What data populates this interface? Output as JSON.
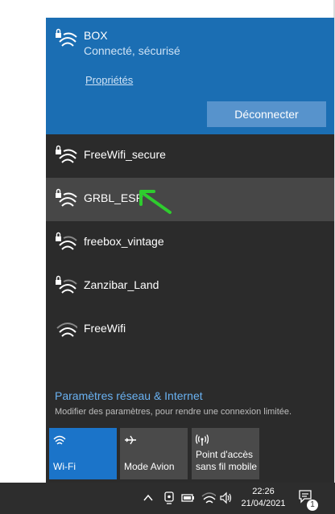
{
  "connected": {
    "ssid": "BOX",
    "status": "Connecté, sécurisé",
    "properties_label": "Propriétés",
    "disconnect_label": "Déconnecter"
  },
  "networks": [
    {
      "name": "FreeWifi_secure",
      "secured": true
    },
    {
      "name": "GRBL_ESP",
      "secured": true
    },
    {
      "name": "freebox_vintage",
      "secured": true
    },
    {
      "name": "Zanzibar_Land",
      "secured": true
    },
    {
      "name": "FreeWifi",
      "secured": false
    }
  ],
  "settings": {
    "title": "Paramètres réseau & Internet",
    "subtitle": "Modifier des paramètres, pour rendre une connexion limitée."
  },
  "quick_actions": {
    "wifi": {
      "label": "Wi-Fi",
      "icon": "wifi-icon"
    },
    "airplane": {
      "label": "Mode Avion",
      "icon": "airplane-icon"
    },
    "hotspot": {
      "line1": "Point d'accès",
      "line2": "sans fil mobile",
      "icon": "hotspot-icon"
    }
  },
  "taskbar": {
    "time": "22:26",
    "date": "21/04/2021",
    "notification_count": "1"
  },
  "colors": {
    "accent": "#1b6eb3",
    "flyout_bg": "#2b2b2b",
    "tile_active": "#1b74c9",
    "arrow": "#2ecc2e"
  }
}
